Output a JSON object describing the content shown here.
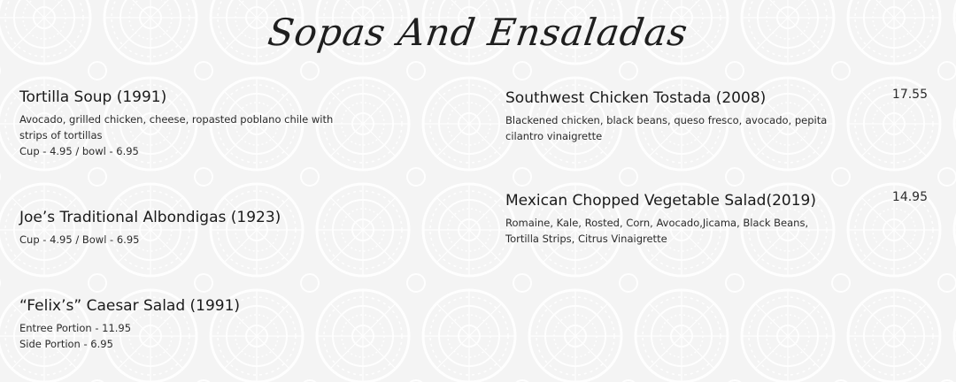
{
  "section": {
    "title": "Sopas And Ensaladas"
  },
  "left_column": [
    {
      "name": "Tortilla Soup (1991)",
      "desc_lines": [
        "Avocado, grilled chicken, cheese, ropasted poblano chile with",
        "strips of tortillas",
        "Cup - 4.95 / bowl - 6.95"
      ]
    },
    {
      "name": "Joe’s Traditional Albondigas (1923)",
      "desc_lines": [
        "Cup - 4.95 / Bowl - 6.95"
      ]
    },
    {
      "name": "“Felix’s” Caesar Salad (1991)",
      "desc_lines": [
        "Entree Portion - 11.95",
        "Side Portion - 6.95"
      ]
    }
  ],
  "right_column": [
    {
      "name": "Southwest Chicken Tostada (2008)",
      "price": "17.55",
      "desc_lines": [
        "Blackened chicken, black beans, queso fresco, avocado, pepita",
        "cilantro vinaigrette"
      ]
    },
    {
      "name": "Mexican Chopped Vegetable Salad(2019)",
      "price": "14.95",
      "desc_lines": [
        "Romaine, Kale, Rosted, Corn, Avocado,Jicama, Black Beans,",
        "Tortilla Strips, Citrus Vinaigrette"
      ]
    }
  ],
  "colors": {
    "background": "#f4f4f4",
    "pattern": "#ffffff",
    "text": "#1c1c1c"
  },
  "icons": {
    "background": "medallion-lace-pattern"
  }
}
